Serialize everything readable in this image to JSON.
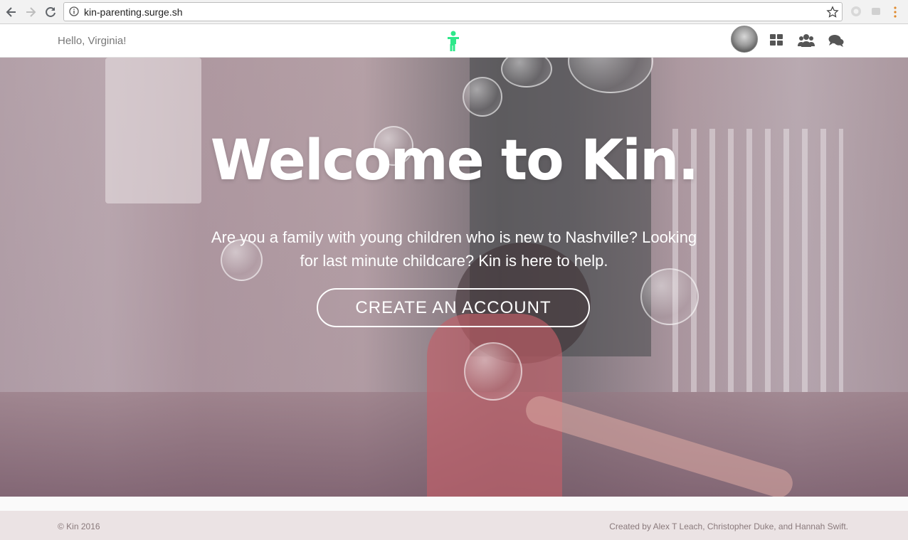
{
  "browser": {
    "url": "kin-parenting.surge.sh",
    "icons": {
      "back": "arrow-left-icon",
      "forward": "arrow-right-icon",
      "reload": "reload-icon",
      "info": "info-icon",
      "bookmark": "star-icon",
      "menu": "menu-dots-icon"
    }
  },
  "header": {
    "greeting": "Hello, Virginia!",
    "logo_color": "#2ee88a",
    "icons": [
      "avatar",
      "dashboard-icon",
      "users-icon",
      "chat-icon"
    ]
  },
  "hero": {
    "title": "Welcome to Kin.",
    "subtitle": "Are you a family with young children who is new to Nashville? Looking for last minute childcare? Kin is here to help.",
    "cta_label": "CREATE AN ACCOUNT"
  },
  "footer": {
    "copyright": "© Kin 2016",
    "credits": "Created by Alex T Leach, Christopher Duke, and Hannah Swift."
  }
}
